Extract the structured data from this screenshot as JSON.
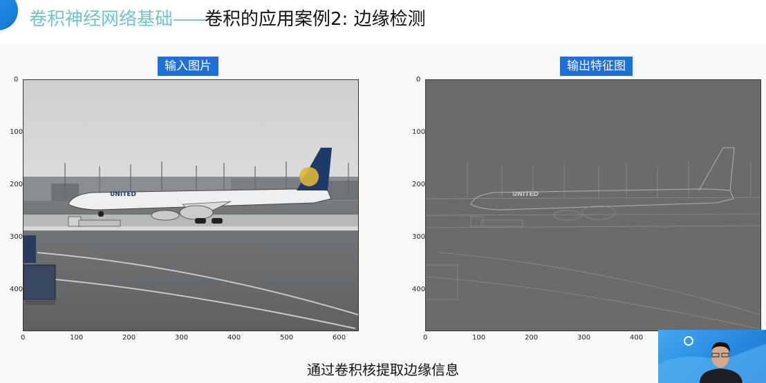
{
  "header": {
    "title_main": "卷积神经网络基础",
    "title_dash": "——",
    "title_sub": "卷积的应用案例2: 边缘检测"
  },
  "left_panel": {
    "label": "输入图片",
    "y_ticks": [
      "0",
      "100",
      "200",
      "300",
      "400"
    ],
    "x_ticks": [
      "0",
      "100",
      "200",
      "300",
      "400",
      "500",
      "600"
    ],
    "image_text": "UNITED"
  },
  "right_panel": {
    "label": "输出特征图",
    "y_ticks": [
      "0",
      "100",
      "200",
      "300",
      "400"
    ],
    "x_ticks": [
      "0",
      "100",
      "200",
      "300",
      "400"
    ],
    "image_text": "UNITED"
  },
  "caption": "通过卷积核提取边缘信息",
  "colors": {
    "accent": "#1f6fd6",
    "title_teal": "#6ec5c9"
  }
}
